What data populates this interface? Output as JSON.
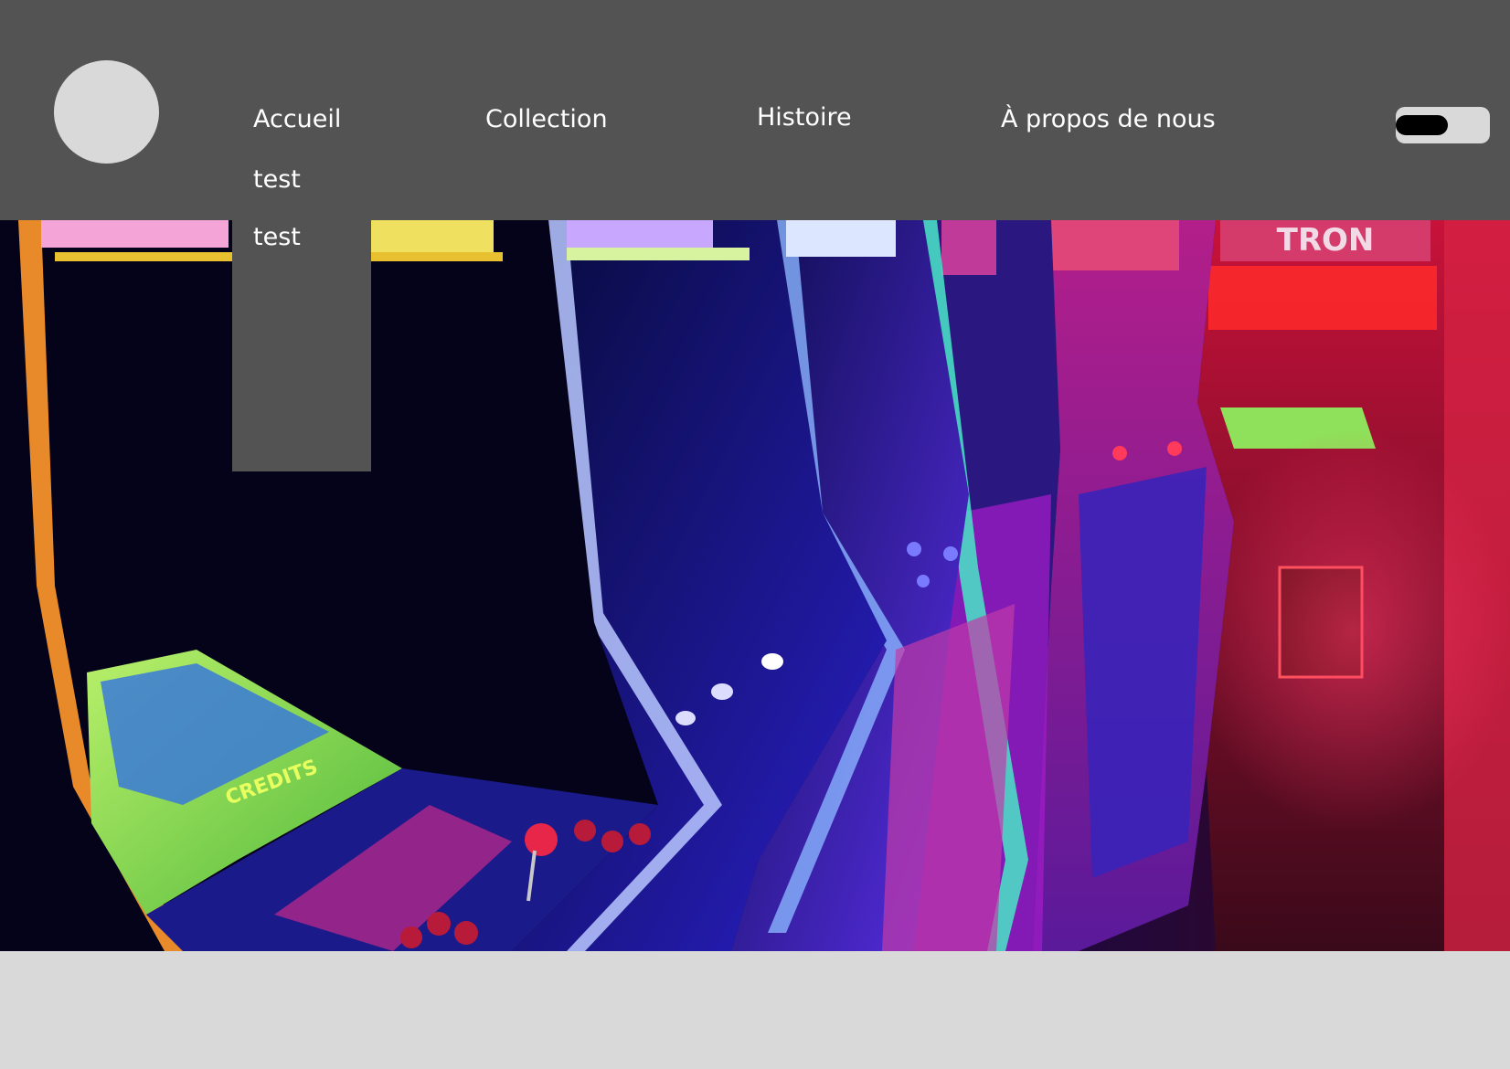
{
  "nav": {
    "links": [
      {
        "label": "Accueil"
      },
      {
        "label": "Collection"
      },
      {
        "label": "Histoire"
      },
      {
        "label": "À propos de nous"
      }
    ],
    "dropdown": {
      "items": [
        {
          "label": "test"
        },
        {
          "label": "test"
        }
      ]
    },
    "theme_toggle": {
      "state": "off"
    }
  },
  "hero": {
    "image": "arcade-cabinets-photo",
    "signs": [
      "TRON"
    ]
  },
  "colors": {
    "header_bg": "#545354",
    "page_bg": "#d9d9d9",
    "text": "#ffffff"
  }
}
